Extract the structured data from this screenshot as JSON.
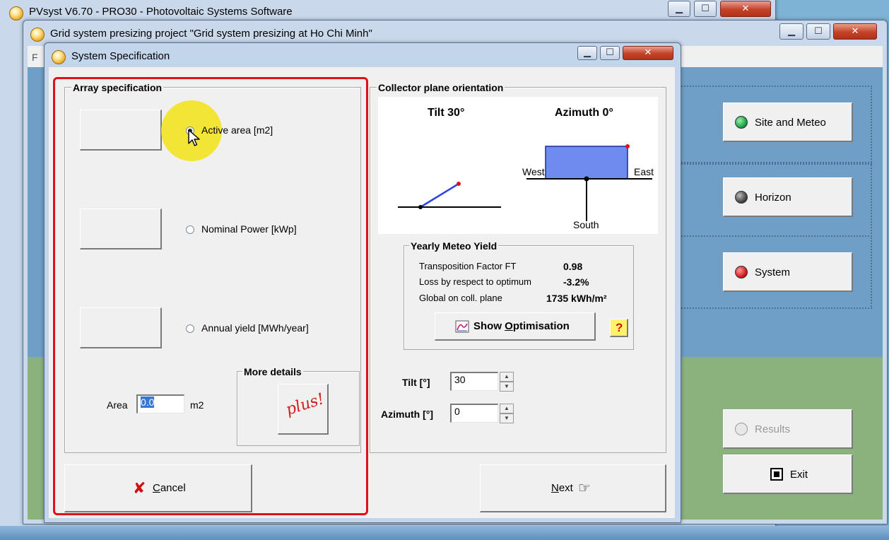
{
  "windows": {
    "main_title": "PVsyst V6.70 - PRO30 - Photovoltaic Systems Software",
    "project_title": "Grid system presizing project  \"Grid system presizing  at  Ho Chi Minh\"",
    "dialog_title": "System Specification",
    "project_menu_letter": "F",
    "caption": {
      "minimize": "▁",
      "maximize": "☐",
      "close": "✕"
    }
  },
  "side_buttons": {
    "site_meteo": "Site and Meteo",
    "horizon": "Horizon",
    "system": "System",
    "results": "Results",
    "exit": "Exit"
  },
  "array_spec": {
    "legend": "Array specification",
    "options": [
      {
        "label": "Active area [m2]",
        "checked": true
      },
      {
        "label": "Nominal Power [kWp]",
        "checked": false
      },
      {
        "label": "Annual yield [MWh/year]",
        "checked": false
      }
    ],
    "area_label": "Area",
    "area_value": "0.0",
    "area_unit": "m2",
    "more_details_legend": "More details",
    "plus_text": "plus!"
  },
  "orientation": {
    "legend": "Collector plane orientation",
    "tilt_caption": "Tilt 30°",
    "azimuth_caption": "Azimuth 0°",
    "west": "West",
    "east": "East",
    "south": "South",
    "tilt_label": "Tilt [°]",
    "tilt_value": "30",
    "azimuth_label": "Azimuth [°]",
    "azimuth_value": "0"
  },
  "meteo_yield": {
    "legend": "Yearly Meteo Yield",
    "rows": [
      {
        "label": "Transposition Factor FT",
        "value": "0.98"
      },
      {
        "label": "Loss by respect to optimum",
        "value": "-3.2%"
      },
      {
        "label": "Global  on coll. plane",
        "value": "1735 kWh/m²"
      }
    ],
    "show_opt_prefix": "Show ",
    "show_opt_underlined": "O",
    "show_opt_suffix": "ptimisation",
    "help": "?"
  },
  "footer": {
    "cancel_underlined": "C",
    "cancel_rest": "ancel",
    "next_underlined": "N",
    "next_rest": "ext"
  },
  "colors": {
    "highlight_circle": "#f2e21a",
    "annotation_red": "#e0101a",
    "panel_blue": "#6e8cf0",
    "tilt_line_blue": "#2a40e8",
    "led_green": "#1fa54a",
    "led_red": "#d81e1e",
    "led_gray": "#4a4a4a"
  }
}
